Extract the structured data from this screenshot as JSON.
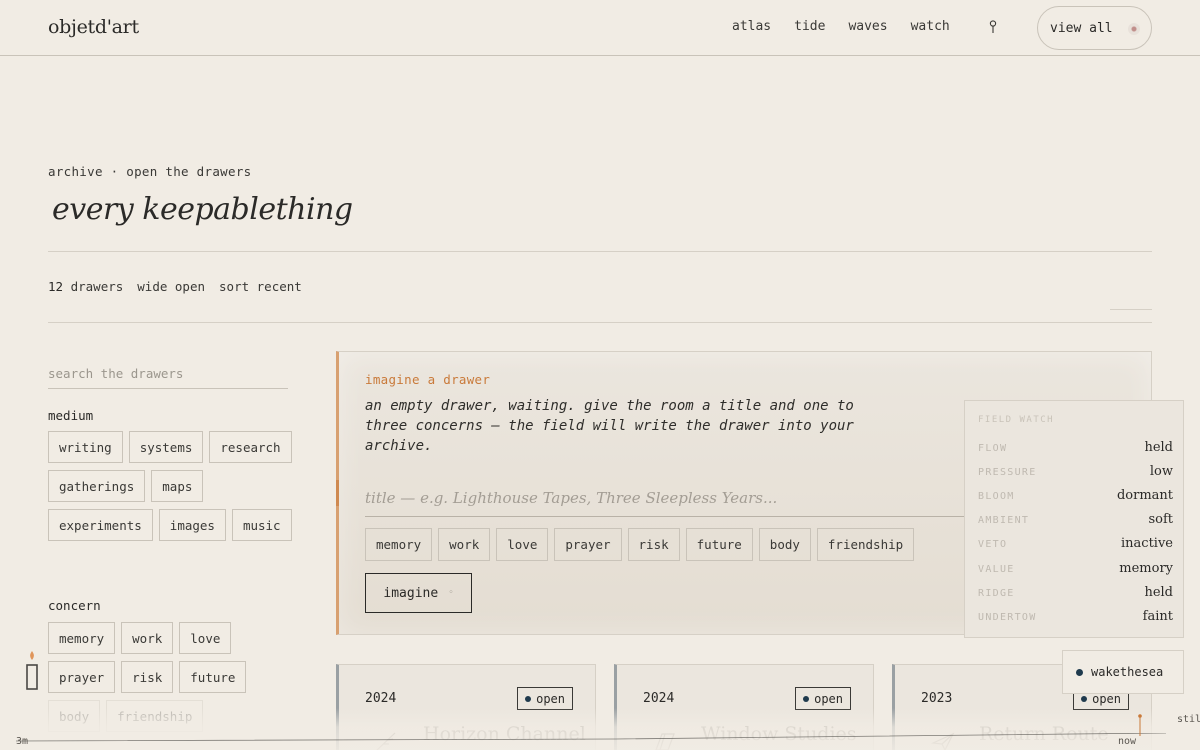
{
  "brand": "objetd'art",
  "nav": [
    "atlas",
    "tide",
    "waves",
    "watch"
  ],
  "view_all": "view all",
  "hero": {
    "eyebrow": "archive · open the drawers",
    "title": "every keepablething"
  },
  "meta": {
    "count": "12",
    "count_label": "drawers",
    "mode": "wide open",
    "sort": "sort recent"
  },
  "sidebar": {
    "search_placeholder": "search the drawers",
    "medium_label": "medium",
    "medium": [
      "writing",
      "systems",
      "research",
      "gatherings",
      "maps",
      "experiments",
      "images",
      "music"
    ],
    "concern_label": "concern",
    "concern": [
      "memory",
      "work",
      "love",
      "prayer",
      "risk",
      "future",
      "body",
      "friendship"
    ]
  },
  "imagine": {
    "eyebrow": "imagine a drawer",
    "description": "an empty drawer, waiting. give the room a title and one to three concerns — the field will write the drawer into your archive.",
    "title_placeholder": "title — e.g. Lighthouse Tapes, Three Sleepless Years...",
    "concerns": [
      "memory",
      "work",
      "love",
      "prayer",
      "risk",
      "future",
      "body",
      "friendship"
    ],
    "button": "imagine",
    "button_glyph": "◦"
  },
  "field_watch": {
    "title": "FIELD WATCH",
    "rows": [
      {
        "key": "FLOW",
        "value": "held"
      },
      {
        "key": "PRESSURE",
        "value": "low"
      },
      {
        "key": "BLOOM",
        "value": "dormant"
      },
      {
        "key": "AMBIENT",
        "value": "soft"
      },
      {
        "key": "VETO",
        "value": "inactive"
      },
      {
        "key": "VALUE",
        "value": "memory"
      },
      {
        "key": "RIDGE",
        "value": "held"
      },
      {
        "key": "UNDERTOW",
        "value": "faint"
      }
    ]
  },
  "wake_badge": "wakethesea",
  "cards": [
    {
      "year": "2024",
      "status": "open",
      "title": "Horizon Channel"
    },
    {
      "year": "2024",
      "status": "open",
      "title": "Window Studies"
    },
    {
      "year": "2023",
      "status": "open",
      "title": "Return Route"
    }
  ],
  "timeline": {
    "start": "3m",
    "end": "now",
    "state": "still"
  },
  "colors": {
    "accent": "#c97a3a",
    "ink": "#2b2a28",
    "paper": "#f1ece4",
    "dot": "#1f3a4d"
  }
}
